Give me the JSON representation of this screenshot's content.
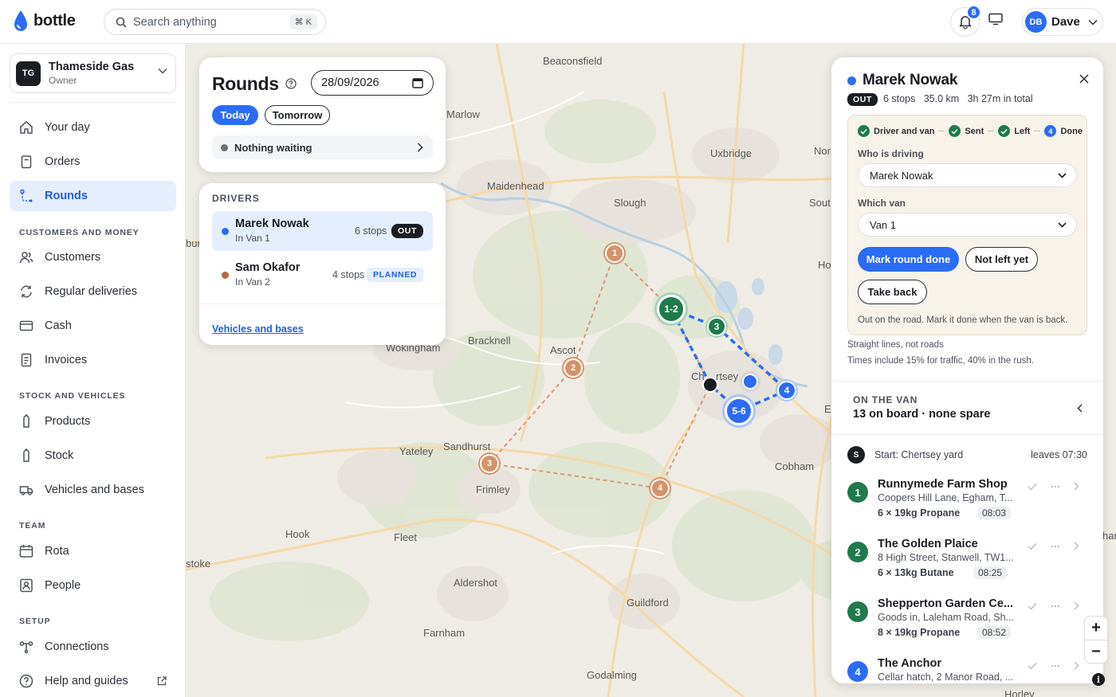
{
  "app": {
    "name": "bottle"
  },
  "search": {
    "placeholder": "Search anything",
    "shortcut": "⌘ K"
  },
  "notifications": {
    "count": "8"
  },
  "user": {
    "initials": "DB",
    "name": "Dave"
  },
  "org": {
    "initials": "TG",
    "name": "Thameside Gas",
    "role": "Owner"
  },
  "nav": {
    "your_day": "Your day",
    "orders": "Orders",
    "rounds": "Rounds",
    "section_customers": "CUSTOMERS AND MONEY",
    "customers": "Customers",
    "regular": "Regular deliveries",
    "cash": "Cash",
    "invoices": "Invoices",
    "section_stock": "STOCK AND VEHICLES",
    "products": "Products",
    "stock": "Stock",
    "vehicles": "Vehicles and bases",
    "section_team": "TEAM",
    "rota": "Rota",
    "people": "People",
    "section_setup": "SETUP",
    "connections": "Connections",
    "help": "Help and guides"
  },
  "rounds": {
    "title": "Rounds",
    "date": "28/09/2026",
    "today": "Today",
    "tomorrow": "Tomorrow",
    "waiting": "Nothing waiting"
  },
  "drivers": {
    "title": "DRIVERS",
    "items": [
      {
        "name": "Marek Nowak",
        "van": "In Van 1",
        "stops": "6 stops",
        "status": "OUT",
        "color": "#2b6cf5"
      },
      {
        "name": "Sam Okafor",
        "van": "In Van 2",
        "stops": "4 stops",
        "status": "PLANNED",
        "color": "#b7683b"
      }
    ],
    "link": "Vehicles and bases"
  },
  "map": {
    "places": [
      "Beaconsfield",
      "Marlow",
      "Uxbridge",
      "Nor",
      "Maidenhead",
      "Slough",
      "Sout",
      "Ho",
      "Bracknell",
      "Ascot",
      "Wokingham",
      "Ch",
      "rtsey",
      "E",
      "Sandhurst",
      "Yateley",
      "Frimley",
      "Cobham",
      "Hook",
      "Fleet",
      "Aldershot",
      "Guildford",
      "Farnham",
      "Godalming",
      "Horley",
      "har",
      "stoke",
      "burn"
    ],
    "markers_van1": [
      "1-2",
      "3",
      "4",
      "5-6"
    ],
    "markers_van2": [
      "1",
      "2",
      "3",
      "4"
    ]
  },
  "panel": {
    "driver": "Marek Nowak",
    "status": "OUT",
    "meta": "6 stops   35.0 km   3h 27m in total",
    "steps": [
      "Driver and van",
      "Sent",
      "Left",
      "Done"
    ],
    "step_num": "4",
    "who_label": "Who is driving",
    "who_value": "Marek Nowak",
    "van_label": "Which van",
    "van_value": "Van 1",
    "btn_done": "Mark round done",
    "btn_not_left": "Not left yet",
    "btn_take_back": "Take back",
    "wf_note": "Out on the road. Mark it done when the van is back.",
    "note1": "Straight lines, not roads",
    "note2": "Times include 15% for traffic, 40% in the rush.",
    "on_van_title": "ON THE VAN",
    "on_van_summary": "13 on board · none spare",
    "start_icon": "S",
    "start_label": "Start: Chertsey yard",
    "start_time": "leaves 07:30",
    "stops": [
      {
        "num": "1",
        "name": "Runnymede Farm Shop",
        "address": "Coopers Hill Lane, Egham, T...",
        "load": "6 × 19kg Propane",
        "time": "08:03",
        "color": "#1f7a4c"
      },
      {
        "num": "2",
        "name": "The Golden Plaice",
        "address": "8 High Street, Stanwell, TW1...",
        "load": "6 × 13kg Butane",
        "time": "08:25",
        "color": "#1f7a4c"
      },
      {
        "num": "3",
        "name": "Shepperton Garden Ce...",
        "address": "Goods in, Laleham Road, Sh...",
        "load": "8 × 19kg Propane",
        "time": "08:52",
        "color": "#1f7a4c"
      },
      {
        "num": "4",
        "name": "The Anchor",
        "address": "Cellar hatch, 2 Manor Road, ...",
        "load": "",
        "time": "",
        "color": "#2b6cf5"
      }
    ]
  },
  "zoom": {
    "plus": "+",
    "minus": "−",
    "info": "i"
  }
}
